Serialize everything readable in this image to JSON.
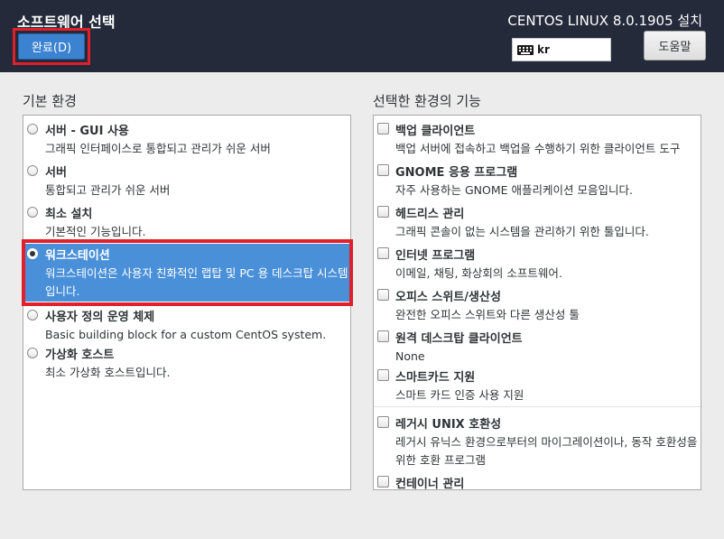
{
  "header": {
    "screen_title": "소프트웨어 선택",
    "done_label": "완료(D)",
    "install_title": "CENTOS LINUX 8.0.1905 설치",
    "keyboard_layout": "kr",
    "help_label": "도움말"
  },
  "base_environment": {
    "label": "기본 환경",
    "items": [
      {
        "title": "서버 - GUI 사용",
        "desc": "그래픽 인터페이스로 통합되고 관리가 쉬운 서버",
        "selected": false
      },
      {
        "title": "서버",
        "desc": "통합되고 관리가 쉬운 서버",
        "selected": false
      },
      {
        "title": "최소 설치",
        "desc": "기본적인 기능입니다.",
        "selected": false
      },
      {
        "title": "워크스테이션",
        "desc": "워크스테이션은 사용자 친화적인 랩탑 및 PC 용 데스크탑 시스템입니다.",
        "selected": true
      },
      {
        "title": "사용자 정의 운영 체제",
        "desc": "Basic building block for a custom CentOS system.",
        "selected": false
      },
      {
        "title": "가상화 호스트",
        "desc": "최소 가상화 호스트입니다.",
        "selected": false
      }
    ]
  },
  "addons": {
    "label": "선택한 환경의 기능",
    "items": [
      {
        "title": "백업 클라이언트",
        "desc": "백업 서버에 접속하고 백업을 수행하기 위한 클라이언트 도구",
        "checked": false
      },
      {
        "title": "GNOME 응용 프로그램",
        "desc": "자주 사용하는 GNOME 애플리케이션 모음입니다.",
        "checked": false
      },
      {
        "title": "헤드리스 관리",
        "desc": "그래픽 콘솔이 없는 시스템을 관리하기 위한 툴입니다.",
        "checked": false
      },
      {
        "title": "인터넷 프로그램",
        "desc": "이메일, 채팅, 화상회의 소프트웨어.",
        "checked": false
      },
      {
        "title": "오피스 스위트/생산성",
        "desc": "완전한 오피스 스위트와 다른 생산성 툴",
        "checked": false
      },
      {
        "title": "원격 데스크탑 클라이언트",
        "desc": "None",
        "checked": false
      },
      {
        "title": "스마트카드 지원",
        "desc": "스마트 카드 인증 사용 지원",
        "checked": false
      },
      {
        "title": "레거시 UNIX 호환성",
        "desc": "레거시 유닉스 환경으로부터의 마이그레이션이나, 동작 호환성을 위한 호환 프로그램",
        "checked": false
      },
      {
        "title": "컨테이너 관리",
        "desc": "",
        "checked": false
      }
    ]
  },
  "colors": {
    "header_bg": "#242a3a",
    "selection_blue": "#4a90d9",
    "highlight_red": "#e0202a"
  }
}
